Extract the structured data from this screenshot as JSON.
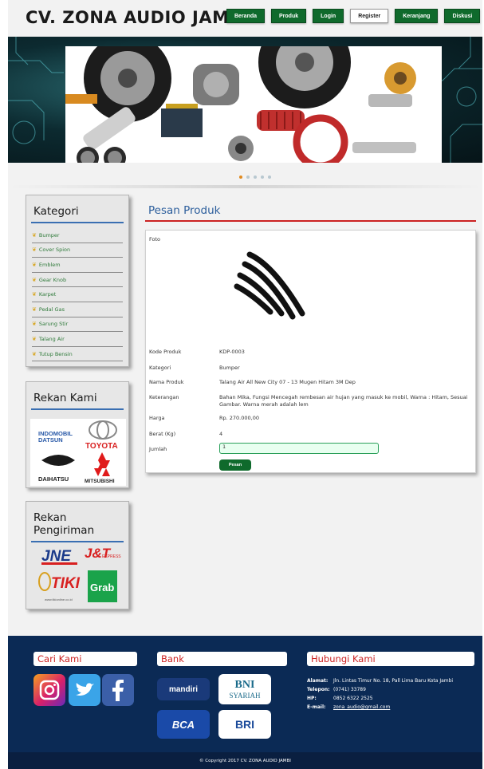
{
  "header": {
    "brand": "CV. ZONA AUDIO JAMBI",
    "nav": [
      "Beranda",
      "Produk",
      "Login",
      "Register",
      "Keranjang",
      "Diskusi"
    ]
  },
  "slider": {
    "dot_count": 5,
    "active_dot": 0
  },
  "sidebar": {
    "kategori_title": "Kategori",
    "categories": [
      "Bumper",
      "Cover Spion",
      "Emblem",
      "Gear Knob",
      "Karpet",
      "Pedal Gas",
      "Sarung Stir",
      "Talang Air",
      "Tutup Bensin"
    ],
    "rekan_title": "Rekan Kami",
    "rekan_logos": [
      "INDOMOBIL",
      "DATSUN",
      "TOYOTA",
      "DAIHATSU",
      "MITSUBISHI"
    ],
    "pengiriman_title": "Rekan Pengiriman",
    "pengiriman_logos": [
      "JNE",
      "J&T",
      "EXPRESS",
      "TIKI",
      "www.tikionline.co.id",
      "Grab"
    ]
  },
  "main": {
    "title": "Pesan Produk",
    "foto_label": "Foto",
    "fields": [
      {
        "label": "Kode Produk",
        "value": "KDP-0003"
      },
      {
        "label": "Kategori",
        "value": "Bumper"
      },
      {
        "label": "Nama Produk",
        "value": "Talang Air All New City 07 - 13 Mugen Hitam 3M Dep"
      },
      {
        "label": "Keterangan",
        "value": "Bahan Mika, Fungsi Mencegah rembesan air hujan yang masuk ke mobil, Warna : Hitam, Sesuai Gambar. Warna merah adalah lem"
      },
      {
        "label": "Harga",
        "value": "Rp. 270.000,00"
      },
      {
        "label": "Berat (Kg)",
        "value": "4"
      }
    ],
    "jumlah_label": "Jumlah",
    "jumlah_value": "1",
    "order_button": "Pesan"
  },
  "footer": {
    "cari_title": "Cari Kami",
    "bank_title": "Bank",
    "hubungi_title": "Hubungi Kami",
    "socials": [
      "instagram-icon",
      "twitter-icon",
      "facebook-icon"
    ],
    "banks": [
      "mandiri",
      "BNI",
      "SYARIAH",
      "BCA",
      "BRI"
    ],
    "contact": {
      "alamat_label": "Alamat:",
      "alamat": "Jln. Lintas Timur No. 18, Pall Lima Baru Kota Jambi",
      "telepon_label": "Telepon:",
      "telepon": "(0741) 33789",
      "hp_label": "HP:",
      "hp": "0852 6322 2525",
      "email_label": "E-mail:",
      "email": "zona_audio@gmail.com"
    },
    "copyright": "© Copyright 2017 CV. ZONA AUDIO JAMBI"
  },
  "colors": {
    "nav_green": "#0f6a2c",
    "footer_navy": "#0b2a55",
    "title_blue": "#2c5e9c",
    "accent_red": "#cc2222"
  }
}
